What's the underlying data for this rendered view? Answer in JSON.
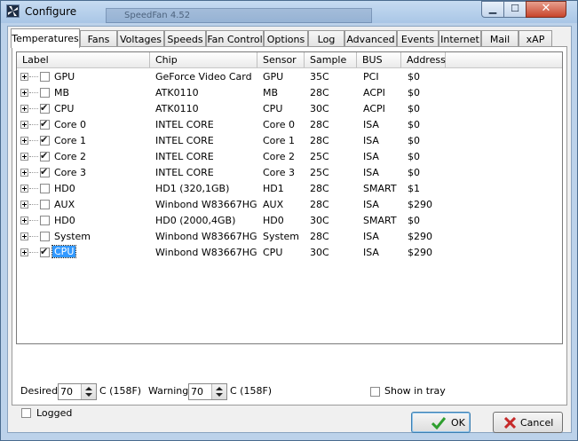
{
  "window": {
    "title": "Configure",
    "background_window_text": "SpeedFan 4.52"
  },
  "tabs": [
    {
      "label": "Temperatures",
      "active": true
    },
    {
      "label": "Fans",
      "active": false
    },
    {
      "label": "Voltages",
      "active": false
    },
    {
      "label": "Speeds",
      "active": false
    },
    {
      "label": "Fan Control",
      "active": false
    },
    {
      "label": "Options",
      "active": false
    },
    {
      "label": "Log",
      "active": false
    },
    {
      "label": "Advanced",
      "active": false
    },
    {
      "label": "Events",
      "active": false
    },
    {
      "label": "Internet",
      "active": false
    },
    {
      "label": "Mail",
      "active": false
    },
    {
      "label": "xAP",
      "active": false
    }
  ],
  "columns": [
    "Label",
    "Chip",
    "Sensor",
    "Sample",
    "BUS",
    "Address"
  ],
  "rows": [
    {
      "checked": false,
      "selected": false,
      "label": "GPU",
      "chip": "GeForce Video Card",
      "sensor": "GPU",
      "sample": "35C",
      "bus": "PCI",
      "address": "$0"
    },
    {
      "checked": false,
      "selected": false,
      "label": "MB",
      "chip": "ATK0110",
      "sensor": "MB",
      "sample": "28C",
      "bus": "ACPI",
      "address": "$0"
    },
    {
      "checked": true,
      "selected": false,
      "label": "CPU",
      "chip": "ATK0110",
      "sensor": "CPU",
      "sample": "30C",
      "bus": "ACPI",
      "address": "$0"
    },
    {
      "checked": true,
      "selected": false,
      "label": "Core 0",
      "chip": "INTEL CORE",
      "sensor": "Core 0",
      "sample": "28C",
      "bus": "ISA",
      "address": "$0"
    },
    {
      "checked": true,
      "selected": false,
      "label": "Core 1",
      "chip": "INTEL CORE",
      "sensor": "Core 1",
      "sample": "28C",
      "bus": "ISA",
      "address": "$0"
    },
    {
      "checked": true,
      "selected": false,
      "label": "Core 2",
      "chip": "INTEL CORE",
      "sensor": "Core 2",
      "sample": "25C",
      "bus": "ISA",
      "address": "$0"
    },
    {
      "checked": true,
      "selected": false,
      "label": "Core 3",
      "chip": "INTEL CORE",
      "sensor": "Core 3",
      "sample": "25C",
      "bus": "ISA",
      "address": "$0"
    },
    {
      "checked": false,
      "selected": false,
      "label": "HD0",
      "chip": "HD1 (320,1GB)",
      "sensor": "HD1",
      "sample": "28C",
      "bus": "SMART",
      "address": "$1"
    },
    {
      "checked": false,
      "selected": false,
      "label": "AUX",
      "chip": "Winbond W83667HG",
      "sensor": "AUX",
      "sample": "28C",
      "bus": "ISA",
      "address": "$290"
    },
    {
      "checked": false,
      "selected": false,
      "label": "HD0",
      "chip": "HD0 (2000,4GB)",
      "sensor": "HD0",
      "sample": "30C",
      "bus": "SMART",
      "address": "$0"
    },
    {
      "checked": false,
      "selected": false,
      "label": "System",
      "chip": "Winbond W83667HG",
      "sensor": "System",
      "sample": "28C",
      "bus": "ISA",
      "address": "$290"
    },
    {
      "checked": true,
      "selected": true,
      "label": "CPU",
      "chip": "Winbond W83667HG",
      "sensor": "CPU",
      "sample": "30C",
      "bus": "ISA",
      "address": "$290"
    }
  ],
  "settings": {
    "desired_label": "Desired",
    "desired_value": "70",
    "desired_unit": "C (158F)",
    "warning_label": "Warning",
    "warning_value": "70",
    "warning_unit": "C (158F)",
    "show_in_tray_label": "Show in tray",
    "show_in_tray_checked": false,
    "logged_label": "Logged",
    "logged_checked": false
  },
  "buttons": {
    "ok_label": "OK",
    "cancel_label": "Cancel"
  },
  "colors": {
    "selection": "#3399ff",
    "ok_check": "#2e9e2e",
    "cancel_x": "#c62a2a",
    "titlebar": "#bcd2ea"
  },
  "icons": {
    "ok": "check-icon",
    "cancel": "x-icon",
    "app": "speedfan-icon"
  }
}
